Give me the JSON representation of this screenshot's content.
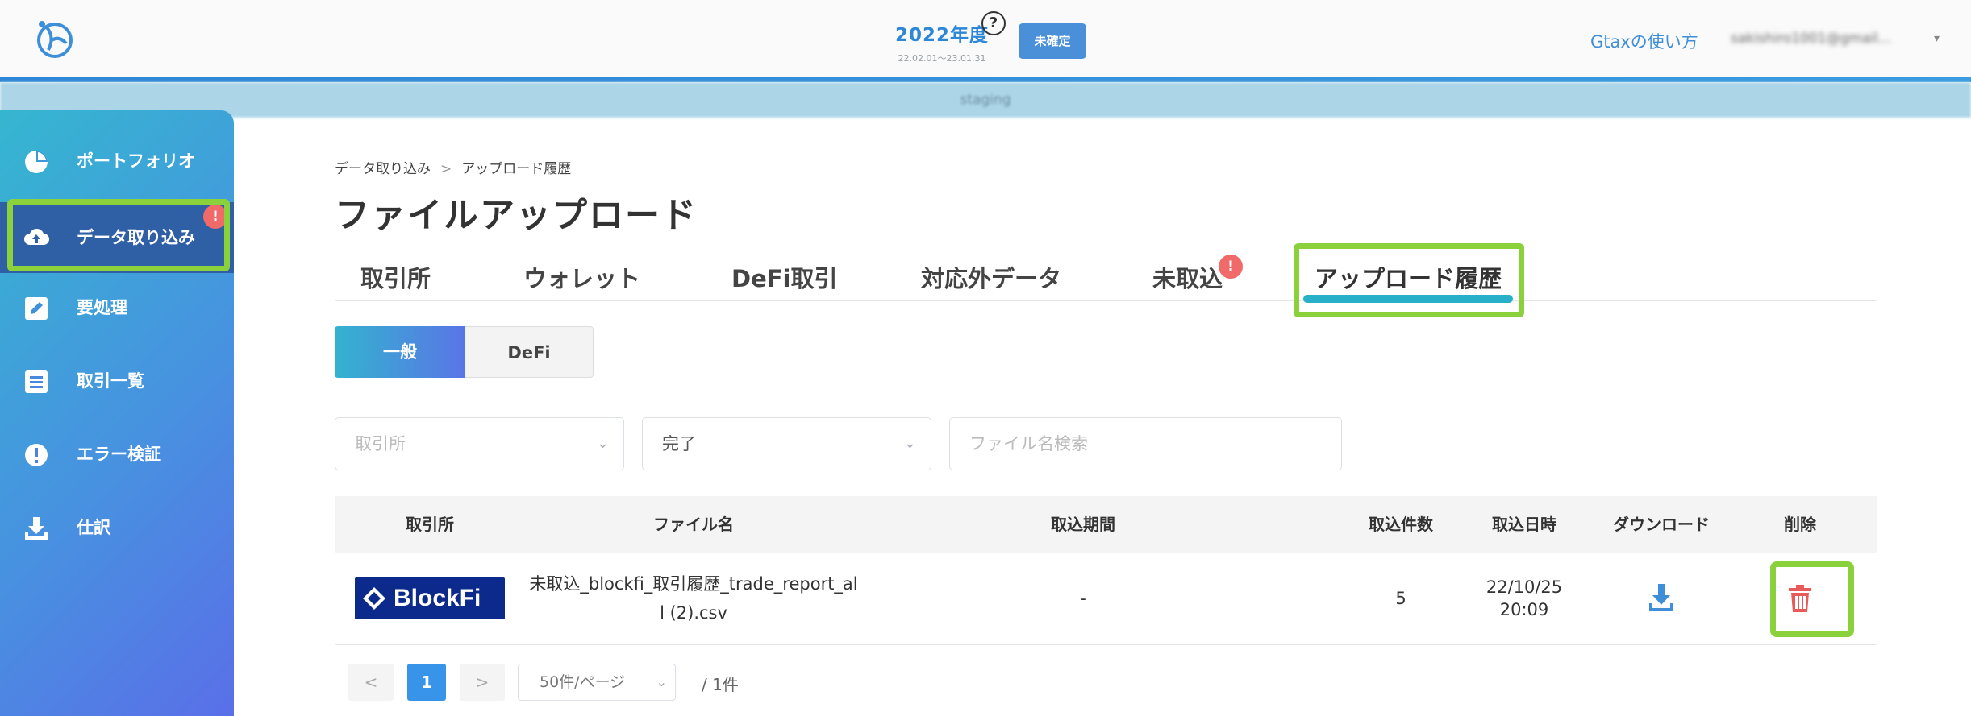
{
  "header": {
    "fiscal_year": "2022年度",
    "fiscal_range": "22.02.01〜23.01.31",
    "help_symbol": "?",
    "status_button": "未確定",
    "help_link": "Gtaxの使い方",
    "account": "sakishiro1001@gmail..."
  },
  "staging_banner": "staging",
  "sidebar": {
    "items": [
      {
        "label": "ポートフォリオ",
        "icon": "pie-chart-icon"
      },
      {
        "label": "データ取り込み",
        "icon": "cloud-upload-icon",
        "active": true,
        "badge": "!"
      },
      {
        "label": "要処理",
        "icon": "edit-icon"
      },
      {
        "label": "取引一覧",
        "icon": "list-icon"
      },
      {
        "label": "エラー検証",
        "icon": "alert-icon"
      },
      {
        "label": "仕訳",
        "icon": "download-icon"
      }
    ]
  },
  "breadcrumb": {
    "parent": "データ取り込み",
    "separator": ">",
    "current": "アップロード履歴"
  },
  "page_title": "ファイルアップロード",
  "tabs": [
    {
      "label": "取引所"
    },
    {
      "label": "ウォレット"
    },
    {
      "label": "DeFi取引"
    },
    {
      "label": "対応外データ"
    },
    {
      "label": "未取込",
      "badge": "!"
    },
    {
      "label": "アップロード履歴",
      "active": true
    }
  ],
  "segment": {
    "general": "一般",
    "defi": "DeFi"
  },
  "filters": {
    "exchange_placeholder": "取引所",
    "status_value": "完了",
    "filename_placeholder": "ファイル名検索"
  },
  "table": {
    "headers": [
      "取引所",
      "ファイル名",
      "取込期間",
      "取込件数",
      "取込日時",
      "ダウンロード",
      "削除"
    ],
    "rows": [
      {
        "exchange_logo": "BlockFi",
        "file_name_line1": "未取込_blockfi_取引履歴_trade_report_al",
        "file_name_line2": "l (2).csv",
        "period": "-",
        "count": "5",
        "date": "22/10/25",
        "time": "20:09",
        "download_icon": "download-icon",
        "delete_icon": "trash-icon"
      }
    ]
  },
  "pagination": {
    "prev": "<",
    "current": "1",
    "next": ">",
    "page_size": "50件/ページ",
    "total": "/ 1件"
  },
  "colors": {
    "accent": "#3794e8",
    "highlight": "#8bd13c",
    "badge": "#f06a6a",
    "delete": "#e85a5a"
  }
}
